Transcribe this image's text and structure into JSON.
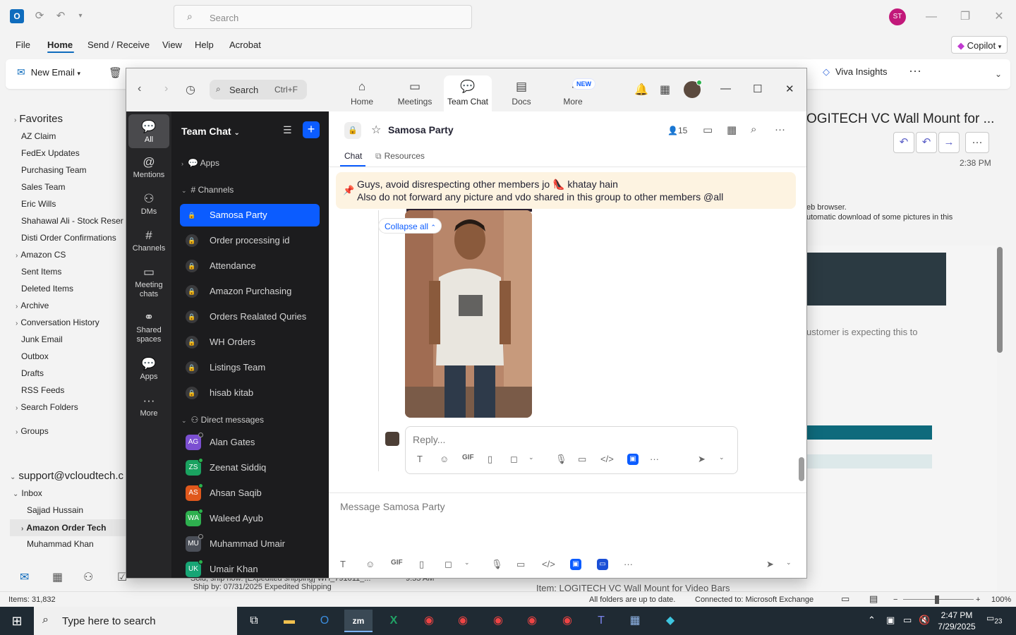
{
  "outlook": {
    "search_placeholder": "Search",
    "avatar_initials": "ST",
    "menu": [
      "File",
      "Home",
      "Send / Receive",
      "View",
      "Help",
      "Acrobat"
    ],
    "copilot": "Copilot",
    "new_email": "New Email",
    "viva": "Viva Insights",
    "favorites": "Favorites",
    "folders": [
      "AZ Claim",
      "FedEx Updates",
      "Purchasing Team",
      "Sales Team",
      "Eric Wills",
      "Shahawal Ali - Stock Reser",
      "Disti Order Confirmations",
      "Amazon CS",
      "Sent Items",
      "Deleted Items",
      "Archive",
      "Conversation History",
      "Junk Email",
      "Outbox",
      "Drafts",
      "RSS Feeds",
      "Search Folders"
    ],
    "groups": "Groups",
    "account": "support@vcloudtech.c",
    "inbox": "Inbox",
    "inbox_children": [
      "Sajjad Hussain",
      "Amazon Order Tech",
      "Muhammad Khan"
    ],
    "message": {
      "subject": "OGITECH VC Wall Mount for ...",
      "time": "2:38 PM",
      "note1": "eb browser.",
      "note2": "utomatic download of some pictures in this",
      "body_text": "ustomer is expecting this to"
    },
    "peek": {
      "line1": "Sold, ship now: [Expedited shipping] WH_791011_...",
      "line2": "Ship by: 07/31/2025  Expedited Shipping",
      "time": "9:55 AM",
      "item": "Item: LOGITECH VC Wall Mount for Video Bars"
    },
    "status": {
      "items": "Items: 31,832",
      "sync": "All folders are up to date.",
      "conn": "Connected to: Microsoft Exchange",
      "zoom": "100%"
    }
  },
  "taskbar": {
    "search_placeholder": "Type here to search",
    "time": "2:47 PM",
    "date": "7/29/2025",
    "notifications": "23"
  },
  "zoom": {
    "search": "Search",
    "search_kbd": "Ctrl+F",
    "tabs": [
      "Home",
      "Meetings",
      "Team Chat",
      "Docs",
      "More"
    ],
    "new_badge": "NEW",
    "rail": [
      "All",
      "Mentions",
      "DMs",
      "Channels",
      "Meeting chats",
      "Shared spaces",
      "Apps",
      "More"
    ],
    "list_title": "Team Chat",
    "apps_label": "Apps",
    "channels_label": "Channels",
    "channels": [
      "Samosa Party",
      "Order processing id",
      "Attendance",
      "Amazon Purchasing",
      "Orders Realated Quries",
      "WH Orders",
      "Listings Team",
      "hisab kitab"
    ],
    "dm_label": "Direct messages",
    "dms": [
      {
        "initials": "AG",
        "name": "Alan Gates",
        "color": "#7b4fd1"
      },
      {
        "initials": "ZS",
        "name": "Zeenat Siddiq",
        "color": "#1aa260"
      },
      {
        "initials": "AS",
        "name": "Ahsan Saqib",
        "color": "#e0581c"
      },
      {
        "initials": "WA",
        "name": "Waleed Ayub",
        "color": "#2eb04f"
      },
      {
        "initials": "MU",
        "name": "Muhammad Umair",
        "color": "#4b4f58"
      },
      {
        "initials": "UK",
        "name": "Umair Khan",
        "color": "#17a575"
      }
    ],
    "chat": {
      "title": "Samosa Party",
      "members": "15",
      "tab_chat": "Chat",
      "tab_resources": "Resources",
      "pinned_line1": "Guys, avoid disrespecting other members jo 👠 khatay hain",
      "pinned_line2": "Also do not forward any picture and vdo shared in this group to other members @all",
      "collapse": "Collapse all",
      "reply_placeholder": "Reply...",
      "compose_placeholder": "Message Samosa Party",
      "gif": "GIF"
    }
  }
}
